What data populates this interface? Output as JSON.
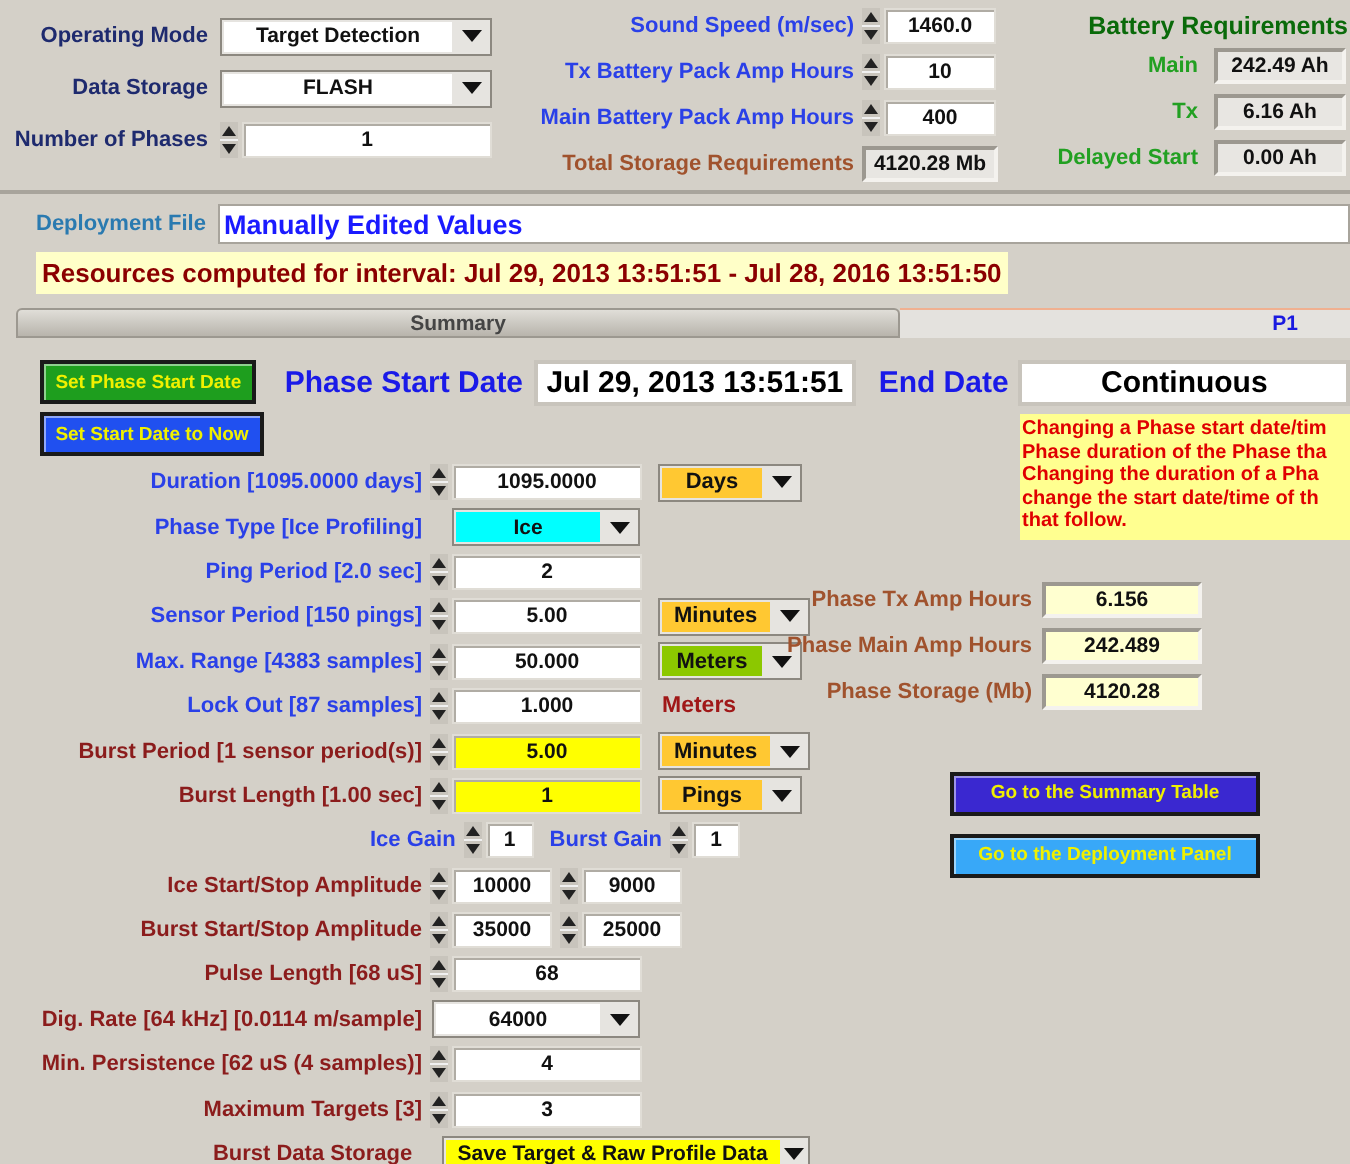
{
  "top": {
    "settings": [
      {
        "label": "Operating Mode",
        "kind": "dropdown",
        "value": "Target Detection"
      },
      {
        "label": "Data Storage",
        "kind": "dropdown",
        "value": "FLASH"
      },
      {
        "label": "Number of Phases",
        "kind": "spinner",
        "value": "1"
      }
    ],
    "parameters": [
      {
        "label": "Sound Speed (m/sec)",
        "kind": "spinner",
        "value": "1460.0"
      },
      {
        "label": "Tx Battery Pack Amp Hours",
        "kind": "spinner",
        "value": "10"
      },
      {
        "label": "Main Battery Pack Amp Hours",
        "kind": "spinner",
        "value": "400"
      },
      {
        "label": "Total Storage Requirements",
        "kind": "readout",
        "value": "4120.28 Mb"
      }
    ],
    "battery": {
      "title": "Battery Requirements",
      "items": [
        {
          "label": "Main",
          "value": "242.49 Ah"
        },
        {
          "label": "Tx",
          "value": "6.16 Ah"
        },
        {
          "label": "Delayed Start",
          "value": "0.00 Ah"
        }
      ]
    }
  },
  "deployment_file": {
    "label": "Deployment File",
    "value": "Manually Edited Values"
  },
  "resources": "Resources computed for interval:  Jul 29, 2013 13:51:51 - Jul 28, 2016 13:51:50",
  "tabs": [
    {
      "label": "Summary",
      "selected": false
    },
    {
      "label": "P1",
      "selected": true
    }
  ],
  "phase": {
    "set_start_button": "Set Phase Start Date",
    "set_now_button": "Set Start Date to Now",
    "start_label": "Phase Start Date",
    "start_value": "Jul 29, 2013 13:51:51",
    "end_label": "End Date",
    "end_value": "Continuous",
    "note_lines": [
      "Changing a Phase start date/tim",
      "Phase duration of the Phase tha",
      "Changing the duration of a Pha",
      "change the start date/time of th",
      "that follow."
    ],
    "rows": [
      {
        "label": "Duration [1095.0000 days]",
        "color": "#2a40e8",
        "kind": "spinner",
        "field": {
          "value": "1095.0000"
        },
        "unit": {
          "kind": "dropdown",
          "label": "Days",
          "color": "#ffc832"
        }
      },
      {
        "label": "Phase Type [Ice Profiling]",
        "color": "#2a40e8",
        "kind": "dropdown",
        "field": {
          "value": "Ice",
          "color": "#00ffff"
        }
      },
      {
        "label": "Ping Period [2.0 sec]",
        "color": "#2a40e8",
        "kind": "spinner",
        "field": {
          "value": "2"
        }
      },
      {
        "label": "Sensor Period [150 pings]",
        "color": "#2a40e8",
        "kind": "spinner",
        "field": {
          "value": "5.00"
        },
        "unit": {
          "kind": "dropdown",
          "label": "Minutes",
          "color": "#ffc832"
        }
      },
      {
        "label": "Max. Range [4383 samples]",
        "color": "#2a40e8",
        "kind": "spinner",
        "field": {
          "value": "50.000"
        },
        "unit": {
          "kind": "dropdown",
          "label": "Meters",
          "color": "#8cc800"
        }
      },
      {
        "label": "Lock Out [87 samples]",
        "color": "#2a40e8",
        "kind": "spinner",
        "field": {
          "value": "1.000"
        },
        "unit": {
          "kind": "text",
          "label": "Meters"
        }
      },
      {
        "label": "Burst Period [1 sensor period(s)]",
        "color": "#8b1c1c",
        "kind": "spinner",
        "field": {
          "value": "5.00",
          "color": "#ffff00"
        },
        "unit": {
          "kind": "dropdown",
          "label": "Minutes",
          "color": "#ffc832"
        }
      },
      {
        "label": "Burst Length [1.00 sec]",
        "color": "#8b1c1c",
        "kind": "spinner",
        "field": {
          "value": "1",
          "color": "#ffff00"
        },
        "unit": {
          "kind": "dropdown",
          "label": "Pings",
          "color": "#ffc832"
        }
      },
      {
        "kind": "gains",
        "color": "#2a40e8",
        "items": [
          {
            "label": "Ice Gain",
            "value": "1"
          },
          {
            "label": "Burst Gain",
            "value": "1"
          }
        ]
      },
      {
        "label": "Ice Start/Stop Amplitude",
        "color": "#8b1c1c",
        "kind": "pair",
        "fields": [
          {
            "value": "10000"
          },
          {
            "value": "9000"
          }
        ]
      },
      {
        "label": "Burst Start/Stop Amplitude",
        "color": "#8b1c1c",
        "kind": "pair",
        "fields": [
          {
            "value": "35000"
          },
          {
            "value": "25000"
          }
        ]
      },
      {
        "label": "Pulse Length [68 uS]",
        "color": "#8b1c1c",
        "kind": "spinner",
        "field": {
          "value": "68"
        }
      },
      {
        "label": "Dig. Rate [64 kHz] [0.0114 m/sample]",
        "color": "#8b1c1c",
        "kind": "dropdown",
        "field": {
          "value": "64000",
          "color": "#ffffff"
        }
      },
      {
        "label": "Min. Persistence [62 uS (4 samples)]",
        "color": "#8b1c1c",
        "kind": "spinner",
        "field": {
          "value": "4"
        }
      },
      {
        "label": "Maximum Targets [3]",
        "color": "#8b1c1c",
        "kind": "spinner",
        "field": {
          "value": "3"
        }
      },
      {
        "label": "Burst Data Storage",
        "color": "#8b1c1c",
        "kind": "dropdown",
        "field": {
          "value": "Save Target & Raw Profile Data",
          "color": "#ffff00"
        }
      }
    ],
    "results": [
      {
        "label": "Phase Tx Amp Hours",
        "value": "6.156"
      },
      {
        "label": "Phase Main Amp Hours",
        "value": "242.489"
      },
      {
        "label": "Phase Storage (Mb)",
        "value": "4120.28"
      }
    ],
    "nav_buttons": [
      {
        "label": "Go to  the Summary  Table",
        "kind": "summary"
      },
      {
        "label": "Go to the Deployment Panel",
        "kind": "deployment"
      }
    ]
  }
}
